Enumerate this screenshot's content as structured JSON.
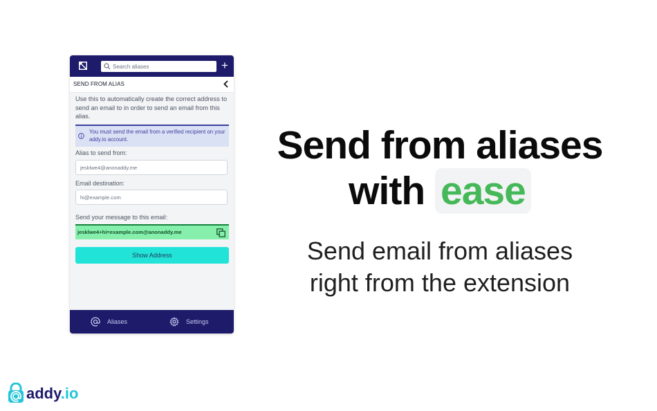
{
  "popup": {
    "search": {
      "placeholder": "Search aliases"
    },
    "header_title": "SEND FROM ALIAS",
    "description": "Use this to automatically create the correct address to send an email to in order to send an email from this alias.",
    "info_text": "You must send the email from a verified recipient on your addy.io account.",
    "alias_label": "Alias to send from:",
    "alias_value": "jesklwe4@anonaddy.me",
    "destination_label": "Email destination:",
    "destination_value": "hi@example.com",
    "message_label": "Send your message to this email:",
    "generated_address": "jesklwe4+hi=example.com@anonaddy.me",
    "show_button": "Show Address",
    "nav": {
      "aliases": "Aliases",
      "settings": "Settings"
    }
  },
  "headline": {
    "line1": "Send from aliases",
    "line2_prefix": "with",
    "highlight": "ease"
  },
  "subheadline": {
    "line1": "Send email from aliases",
    "line2": "right from the extension"
  },
  "brand": {
    "name_main": "addy",
    "name_suffix": ".io"
  },
  "colors": {
    "navy": "#1e1b6b",
    "accent_green": "#45b859",
    "button_cyan": "#22e3d7",
    "generated_green": "#86efac",
    "info_blue": "#dbe1f5"
  },
  "icons": [
    "extension-logo-icon",
    "search-icon",
    "plus-icon",
    "chevron-left-icon",
    "info-icon",
    "copy-icon",
    "at-icon",
    "gear-icon",
    "lock-logo-icon"
  ]
}
